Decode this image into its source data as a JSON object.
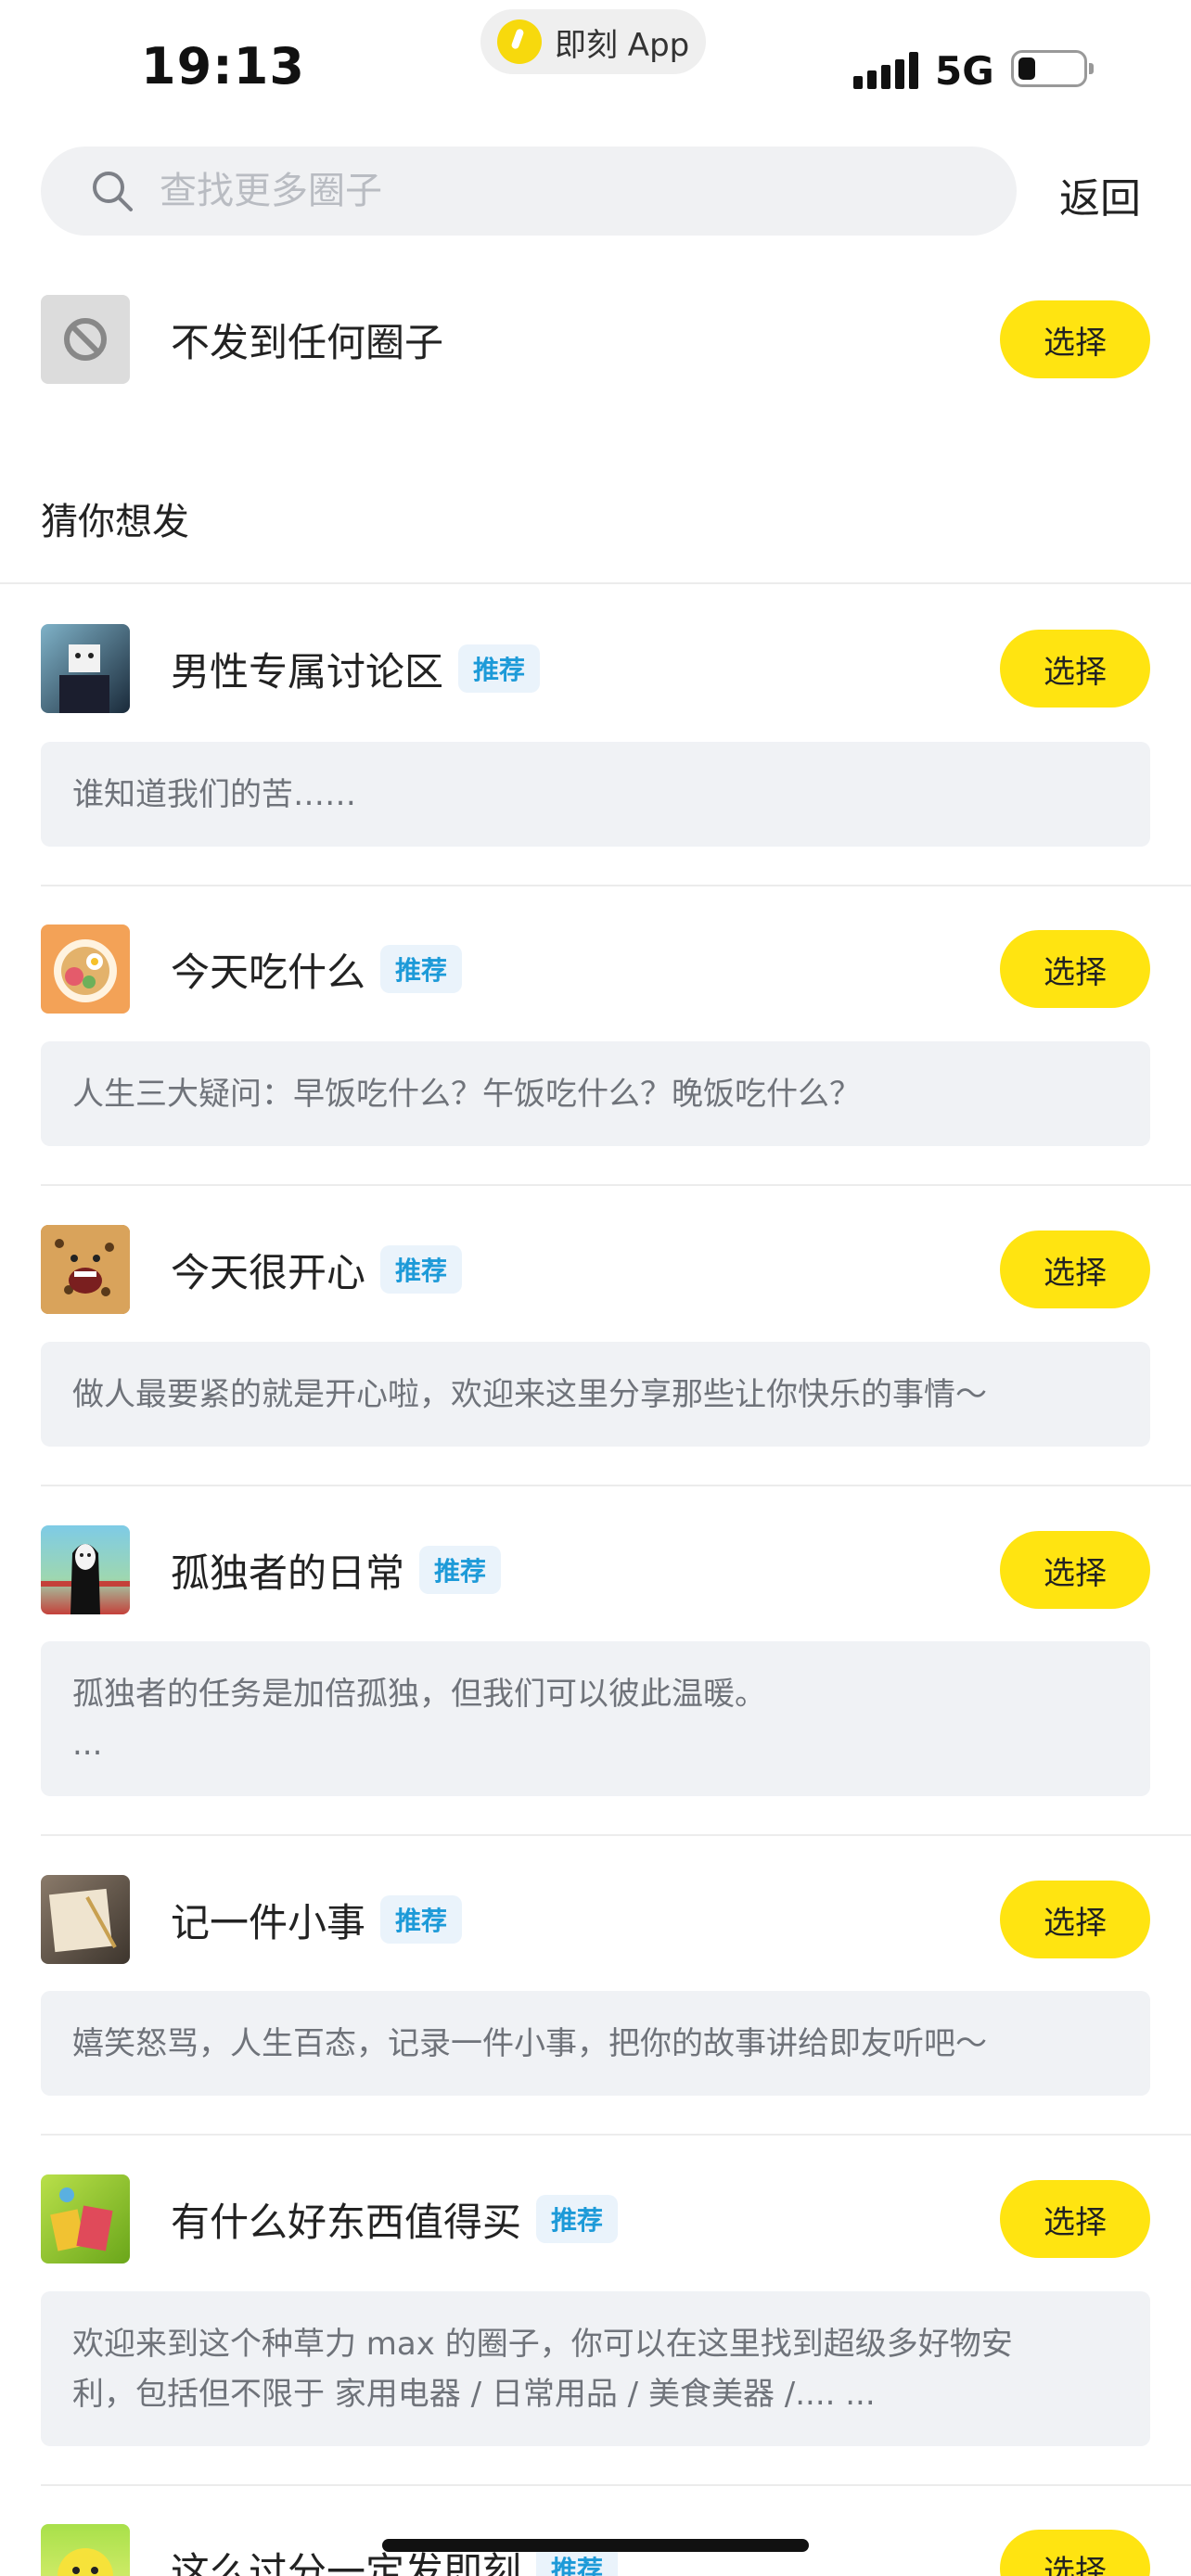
{
  "status_bar": {
    "time": "19:13",
    "app_name": "即刻 App",
    "network": "5G",
    "battery_percent": 20
  },
  "search": {
    "placeholder": "查找更多圈子",
    "back_label": "返回"
  },
  "none_option": {
    "label": "不发到任何圈子",
    "button": "选择",
    "icon": "ban-icon"
  },
  "section_title": "猜你想发",
  "colors": {
    "accent_yellow": "#ffe411",
    "tag_blue": "#1d9ad8",
    "tag_bg": "#eaf3fb",
    "desc_bg": "#f0f2f5"
  },
  "circles": [
    {
      "name": "男性专属讨论区",
      "tag": "推荐",
      "button": "选择",
      "desc_lines": [
        "谁知道我们的苦……"
      ]
    },
    {
      "name": "今天吃什么",
      "tag": "推荐",
      "button": "选择",
      "desc_lines": [
        "人生三大疑问：早饭吃什么？午饭吃什么？晚饭吃什么？"
      ]
    },
    {
      "name": "今天很开心",
      "tag": "推荐",
      "button": "选择",
      "desc_lines": [
        "做人最要紧的就是开心啦，欢迎来这里分享那些让你快乐的事情～"
      ]
    },
    {
      "name": "孤独者的日常",
      "tag": "推荐",
      "button": "选择",
      "desc_lines": [
        "孤独者的任务是加倍孤独，但我们可以彼此温暖。",
        "..."
      ]
    },
    {
      "name": "记一件小事",
      "tag": "推荐",
      "button": "选择",
      "desc_lines": [
        "嬉笑怒骂，人生百态，记录一件小事，把你的故事讲给即友听吧～"
      ]
    },
    {
      "name": "有什么好东西值得买",
      "tag": "推荐",
      "button": "选择",
      "desc_lines": [
        "欢迎来到这个种草力 max 的圈子，你可以在这里找到超级多好物安",
        "利，包括但不限于 家用电器 / 日常用品 / 美食美器 /.... ..."
      ]
    },
    {
      "name": "这么过分一定发即刻",
      "tag": "推荐",
      "button": "选择",
      "desc_lines": []
    }
  ]
}
